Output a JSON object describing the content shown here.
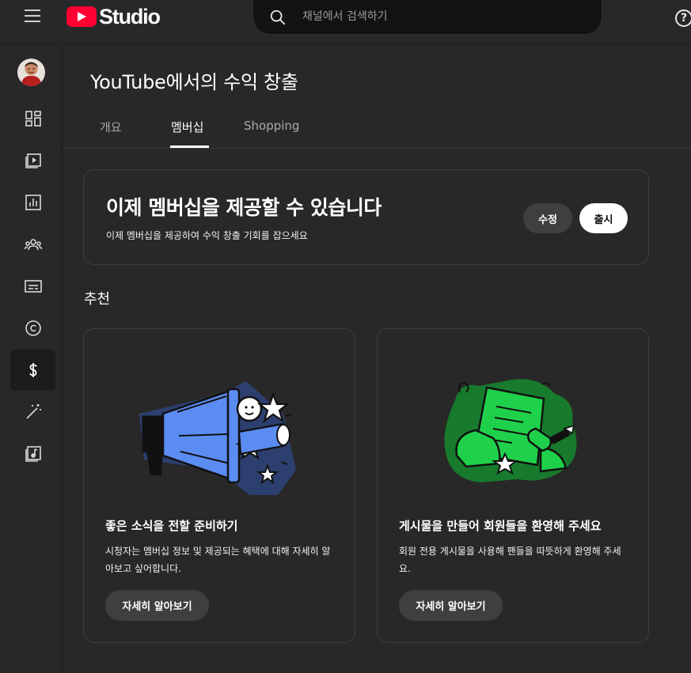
{
  "header": {
    "logo_text": "Studio",
    "search_placeholder": "채널에서 검색하기",
    "help_glyph": "?"
  },
  "page": {
    "title": "YouTube에서의 수익 창출",
    "tabs": [
      {
        "label": "개요",
        "active": false
      },
      {
        "label": "멤버십",
        "active": true
      },
      {
        "label": "Shopping",
        "active": false
      }
    ]
  },
  "promo": {
    "title": "이제 멤버십을 제공할 수 있습니다",
    "subtitle": "이제 멤버십을 제공하여 수익 창출 기회를 잡으세요",
    "edit_label": "수정",
    "launch_label": "출시"
  },
  "recommend": {
    "label": "추천",
    "cards": [
      {
        "title": "좋은 소식을 전할 준비하기",
        "description": "시청자는 멤버십 정보 및 제공되는 혜택에 대해 자세히 알아보고 싶어합니다.",
        "button": "자세히 알아보기",
        "illustration": "megaphone-illustration"
      },
      {
        "title": "게시물을 만들어 회원들을 환영해 주세요",
        "description": "회원 전용 게시물을 사용해 팬들을 따뜻하게 환영해 주세요.",
        "button": "자세히 알아보기",
        "illustration": "post-writing-illustration"
      }
    ]
  },
  "sidebar": {
    "items": [
      {
        "icon": "dashboard-icon",
        "active": false
      },
      {
        "icon": "content-icon",
        "active": false
      },
      {
        "icon": "analytics-icon",
        "active": false
      },
      {
        "icon": "community-icon",
        "active": false
      },
      {
        "icon": "subtitles-icon",
        "active": false
      },
      {
        "icon": "copyright-icon",
        "active": false
      },
      {
        "icon": "earn-icon",
        "active": true
      },
      {
        "icon": "customization-icon",
        "active": false
      },
      {
        "icon": "audio-library-icon",
        "active": false
      }
    ]
  },
  "colors": {
    "background": "#282828",
    "accent_red": "#ff0033",
    "card_border": "#3e3e3e",
    "button_dark": "#3f3f3f",
    "illus_blue": "#5b8cf2",
    "illus_green": "#1fd14a"
  }
}
